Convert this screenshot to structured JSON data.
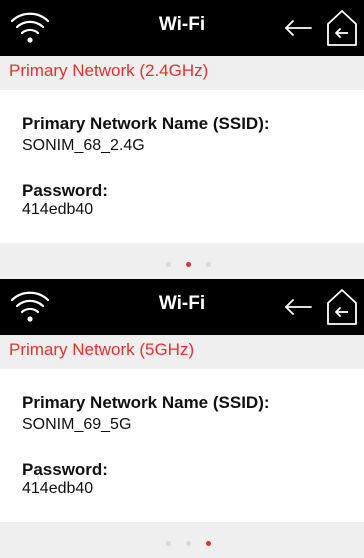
{
  "colors": {
    "accent": "#e4312b",
    "topbar": "#000000",
    "card": "#ffffff",
    "band": "#efefef"
  },
  "screens": [
    {
      "title": "Wi-Fi",
      "section": "Primary Network (2.4GHz)",
      "ssid_label": "Primary Network Name (SSID):",
      "ssid_value": "SONIM_68_2.4G",
      "password_label": "Password:",
      "password_value": "414edb40",
      "page_index": 1,
      "page_count": 3
    },
    {
      "title": "Wi-Fi",
      "section": "Primary Network (5GHz)",
      "ssid_label": "Primary Network Name (SSID):",
      "ssid_value": "SONIM_69_5G",
      "password_label": "Password:",
      "password_value": "414edb40",
      "page_index": 2,
      "page_count": 3
    }
  ],
  "icons": {
    "status": "wifi-icon",
    "back": "back-arrow-icon",
    "home": "home-icon"
  }
}
